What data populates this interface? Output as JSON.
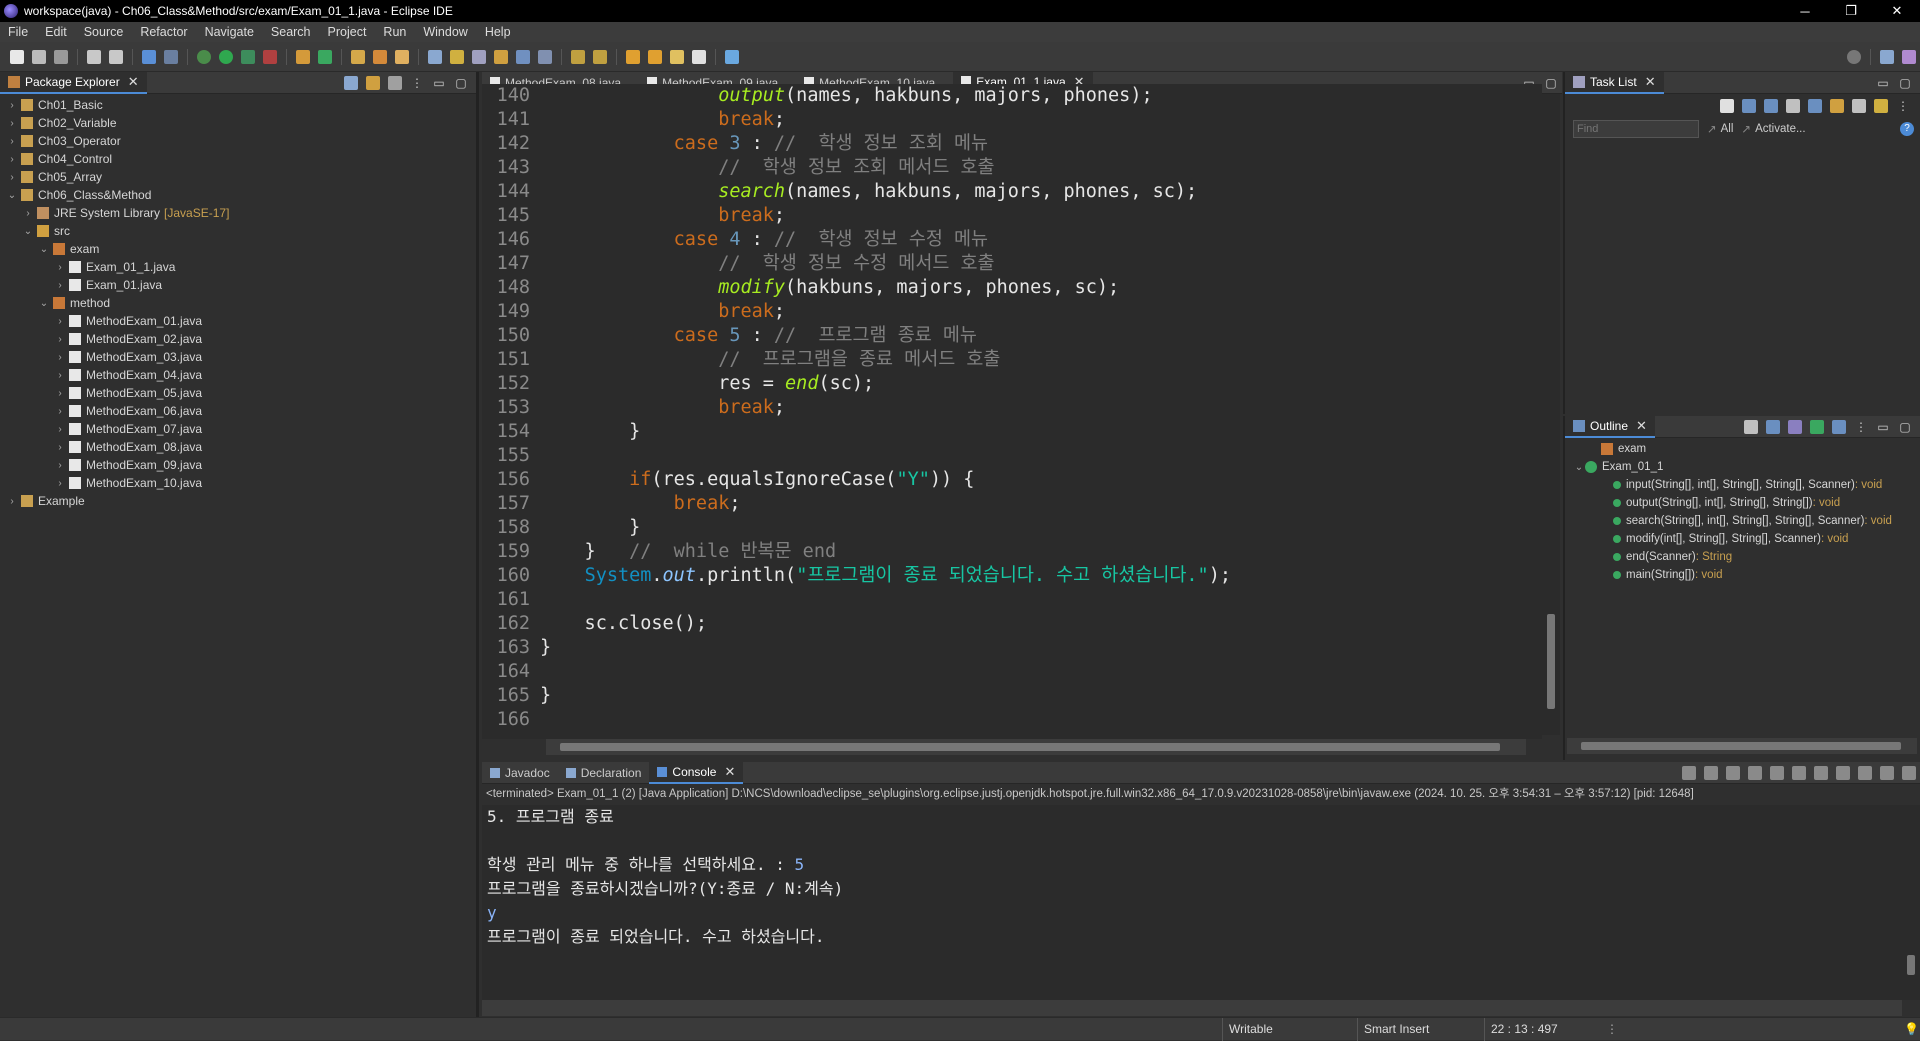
{
  "window": {
    "title": "workspace(java) - Ch06_Class&Method/src/exam/Exam_01_1.java - Eclipse IDE",
    "minimize_glyph": "─",
    "restore_glyph": "❐",
    "close_glyph": "✕"
  },
  "menu": [
    "File",
    "Edit",
    "Source",
    "Refactor",
    "Navigate",
    "Search",
    "Project",
    "Run",
    "Window",
    "Help"
  ],
  "package_explorer": {
    "tab_label": "Package Explorer",
    "items": [
      {
        "label": "Ch01_Basic",
        "indent": 0,
        "expanded": false,
        "type": "project"
      },
      {
        "label": "Ch02_Variable",
        "indent": 0,
        "expanded": false,
        "type": "project"
      },
      {
        "label": "Ch03_Operator",
        "indent": 0,
        "expanded": false,
        "type": "project"
      },
      {
        "label": "Ch04_Control",
        "indent": 0,
        "expanded": false,
        "type": "project"
      },
      {
        "label": "Ch05_Array",
        "indent": 0,
        "expanded": false,
        "type": "project"
      },
      {
        "label": "Ch06_Class&Method",
        "indent": 0,
        "expanded": true,
        "type": "project"
      },
      {
        "label": "JRE System Library",
        "suffix": "[JavaSE-17]",
        "indent": 1,
        "expanded": false,
        "type": "library"
      },
      {
        "label": "src",
        "indent": 1,
        "expanded": true,
        "type": "folder"
      },
      {
        "label": "exam",
        "indent": 2,
        "expanded": true,
        "type": "package"
      },
      {
        "label": "Exam_01_1.java",
        "indent": 3,
        "expanded": false,
        "type": "java"
      },
      {
        "label": "Exam_01.java",
        "indent": 3,
        "expanded": false,
        "type": "java"
      },
      {
        "label": "method",
        "indent": 2,
        "expanded": true,
        "type": "package"
      },
      {
        "label": "MethodExam_01.java",
        "indent": 3,
        "expanded": false,
        "type": "java"
      },
      {
        "label": "MethodExam_02.java",
        "indent": 3,
        "expanded": false,
        "type": "java"
      },
      {
        "label": "MethodExam_03.java",
        "indent": 3,
        "expanded": false,
        "type": "java"
      },
      {
        "label": "MethodExam_04.java",
        "indent": 3,
        "expanded": false,
        "type": "java"
      },
      {
        "label": "MethodExam_05.java",
        "indent": 3,
        "expanded": false,
        "type": "java"
      },
      {
        "label": "MethodExam_06.java",
        "indent": 3,
        "expanded": false,
        "type": "java"
      },
      {
        "label": "MethodExam_07.java",
        "indent": 3,
        "expanded": false,
        "type": "java"
      },
      {
        "label": "MethodExam_08.java",
        "indent": 3,
        "expanded": false,
        "type": "java"
      },
      {
        "label": "MethodExam_09.java",
        "indent": 3,
        "expanded": false,
        "type": "java"
      },
      {
        "label": "MethodExam_10.java",
        "indent": 3,
        "expanded": false,
        "type": "java"
      },
      {
        "label": "Example",
        "indent": 0,
        "expanded": false,
        "type": "project"
      }
    ]
  },
  "editor": {
    "tabs": [
      {
        "label": "MethodExam_08.java",
        "active": false
      },
      {
        "label": "MethodExam_09.java",
        "active": false
      },
      {
        "label": "MethodExam_10.java",
        "active": false
      },
      {
        "label": "Exam_01_1.java",
        "active": true
      }
    ],
    "lines": [
      {
        "n": "140",
        "tokens": [
          [
            "plain",
            "                "
          ],
          [
            "mc",
            "output"
          ],
          [
            "plain",
            "(names, hakbuns, majors, phones);"
          ]
        ]
      },
      {
        "n": "141",
        "tokens": [
          [
            "plain",
            "                "
          ],
          [
            "kw",
            "break"
          ],
          [
            "plain",
            ";"
          ]
        ]
      },
      {
        "n": "142",
        "tokens": [
          [
            "plain",
            "            "
          ],
          [
            "kw",
            "case"
          ],
          [
            "plain",
            " "
          ],
          [
            "num",
            "3"
          ],
          [
            "plain",
            " : "
          ],
          [
            "cm",
            "//  학생 정보 조회 메뉴"
          ]
        ]
      },
      {
        "n": "143",
        "tokens": [
          [
            "plain",
            "                "
          ],
          [
            "cm",
            "//  학생 정보 조회 메서드 호출"
          ]
        ]
      },
      {
        "n": "144",
        "tokens": [
          [
            "plain",
            "                "
          ],
          [
            "mc",
            "search"
          ],
          [
            "plain",
            "(names, hakbuns, majors, phones, sc);"
          ]
        ]
      },
      {
        "n": "145",
        "tokens": [
          [
            "plain",
            "                "
          ],
          [
            "kw",
            "break"
          ],
          [
            "plain",
            ";"
          ]
        ]
      },
      {
        "n": "146",
        "tokens": [
          [
            "plain",
            "            "
          ],
          [
            "kw",
            "case"
          ],
          [
            "plain",
            " "
          ],
          [
            "num",
            "4"
          ],
          [
            "plain",
            " : "
          ],
          [
            "cm",
            "//  학생 정보 수정 메뉴"
          ]
        ]
      },
      {
        "n": "147",
        "tokens": [
          [
            "plain",
            "                "
          ],
          [
            "cm",
            "//  학생 정보 수정 메서드 호출"
          ]
        ]
      },
      {
        "n": "148",
        "tokens": [
          [
            "plain",
            "                "
          ],
          [
            "mc",
            "modify"
          ],
          [
            "plain",
            "(hakbuns, majors, phones, sc);"
          ]
        ]
      },
      {
        "n": "149",
        "tokens": [
          [
            "plain",
            "                "
          ],
          [
            "kw",
            "break"
          ],
          [
            "plain",
            ";"
          ]
        ]
      },
      {
        "n": "150",
        "tokens": [
          [
            "plain",
            "            "
          ],
          [
            "kw",
            "case"
          ],
          [
            "plain",
            " "
          ],
          [
            "num",
            "5"
          ],
          [
            "plain",
            " : "
          ],
          [
            "cm",
            "//  프로그램 종료 메뉴"
          ]
        ]
      },
      {
        "n": "151",
        "tokens": [
          [
            "plain",
            "                "
          ],
          [
            "cm",
            "//  프로그램을 종료 메서드 호출"
          ]
        ]
      },
      {
        "n": "152",
        "tokens": [
          [
            "plain",
            "                res = "
          ],
          [
            "mc",
            "end"
          ],
          [
            "plain",
            "(sc);"
          ]
        ]
      },
      {
        "n": "153",
        "tokens": [
          [
            "plain",
            "                "
          ],
          [
            "kw",
            "break"
          ],
          [
            "plain",
            ";"
          ]
        ]
      },
      {
        "n": "154",
        "tokens": [
          [
            "plain",
            "        }"
          ]
        ]
      },
      {
        "n": "155",
        "tokens": [
          [
            "plain",
            ""
          ]
        ]
      },
      {
        "n": "156",
        "tokens": [
          [
            "plain",
            "        "
          ],
          [
            "kw",
            "if"
          ],
          [
            "plain",
            "(res.equalsIgnoreCase("
          ],
          [
            "str",
            "\"Y\""
          ],
          [
            "plain",
            ")) {"
          ]
        ]
      },
      {
        "n": "157",
        "tokens": [
          [
            "plain",
            "            "
          ],
          [
            "kw",
            "break"
          ],
          [
            "plain",
            ";"
          ]
        ]
      },
      {
        "n": "158",
        "tokens": [
          [
            "plain",
            "        }"
          ]
        ]
      },
      {
        "n": "159",
        "tokens": [
          [
            "plain",
            "    }   "
          ],
          [
            "cm",
            "//  while 반복문 end"
          ]
        ]
      },
      {
        "n": "160",
        "tokens": [
          [
            "plain",
            "    "
          ],
          [
            "cls",
            "System"
          ],
          [
            "plain",
            "."
          ],
          [
            "fld",
            "out"
          ],
          [
            "plain",
            ".println("
          ],
          [
            "str",
            "\"프로그램이 종료 되었습니다. 수고 하셨습니다.\""
          ],
          [
            "plain",
            ");"
          ]
        ]
      },
      {
        "n": "161",
        "tokens": [
          [
            "plain",
            ""
          ]
        ]
      },
      {
        "n": "162",
        "tokens": [
          [
            "plain",
            "    sc.close();"
          ]
        ]
      },
      {
        "n": "163",
        "tokens": [
          [
            "plain",
            "}"
          ]
        ]
      },
      {
        "n": "164",
        "tokens": [
          [
            "plain",
            ""
          ]
        ]
      },
      {
        "n": "165",
        "tokens": [
          [
            "plain",
            "}"
          ]
        ]
      },
      {
        "n": "166",
        "tokens": [
          [
            "plain",
            ""
          ]
        ]
      }
    ]
  },
  "task_list": {
    "tab_label": "Task List",
    "find_placeholder": "Find",
    "all_label": "All",
    "activate_label": "Activate..."
  },
  "outline": {
    "tab_label": "Outline",
    "items": [
      {
        "label": "exam",
        "type": "",
        "indent": 0,
        "kind": "package"
      },
      {
        "label": "Exam_01_1",
        "type": "",
        "indent": 0,
        "kind": "class"
      },
      {
        "label": "input(String[], int[], String[], String[], Scanner)",
        "type": " : void",
        "indent": 1,
        "kind": "method"
      },
      {
        "label": "output(String[], int[], String[], String[])",
        "type": " : void",
        "indent": 1,
        "kind": "method"
      },
      {
        "label": "search(String[], int[], String[], String[], Scanner)",
        "type": " : void",
        "indent": 1,
        "kind": "method"
      },
      {
        "label": "modify(int[], String[], String[], Scanner)",
        "type": " : void",
        "indent": 1,
        "kind": "method"
      },
      {
        "label": "end(Scanner)",
        "type": " : String",
        "indent": 1,
        "kind": "method"
      },
      {
        "label": "main(String[])",
        "type": " : void",
        "indent": 1,
        "kind": "method"
      }
    ]
  },
  "bottom": {
    "tabs": [
      {
        "label": "Javadoc",
        "active": false
      },
      {
        "label": "Declaration",
        "active": false
      },
      {
        "label": "Console",
        "active": true
      }
    ],
    "console_header": "<terminated> Exam_01_1 (2) [Java Application] D:\\NCS\\download\\eclipse_se\\plugins\\org.eclipse.justj.openjdk.hotspot.jre.full.win32.x86_64_17.0.9.v20231028-0858\\jre\\bin\\javaw.exe  (2024. 10. 25. 오후 3:54:31 – 오후 3:57:12) [pid: 12648]",
    "console_lines": [
      {
        "text": "5. 프로그램 종료",
        "input": ""
      },
      {
        "text": "",
        "input": ""
      },
      {
        "text": "학생 관리 메뉴 중 하나를 선택하세요. : ",
        "input": "5"
      },
      {
        "text": "프로그램을 종료하시겠습니까?(Y:종료 / N:계속)",
        "input": ""
      },
      {
        "text": "",
        "input": "y"
      },
      {
        "text": "프로그램이 종료 되었습니다. 수고 하셨습니다.",
        "input": ""
      }
    ]
  },
  "status": {
    "writable": "Writable",
    "insert_mode": "Smart Insert",
    "position": "22 : 13 : 497"
  },
  "colors": {
    "keyword": "#cc6c1d",
    "method_call": "#a7ec21",
    "comment": "#808080",
    "number": "#6897bb",
    "string": "#17c6a3",
    "console_input": "#8ab4f8"
  }
}
